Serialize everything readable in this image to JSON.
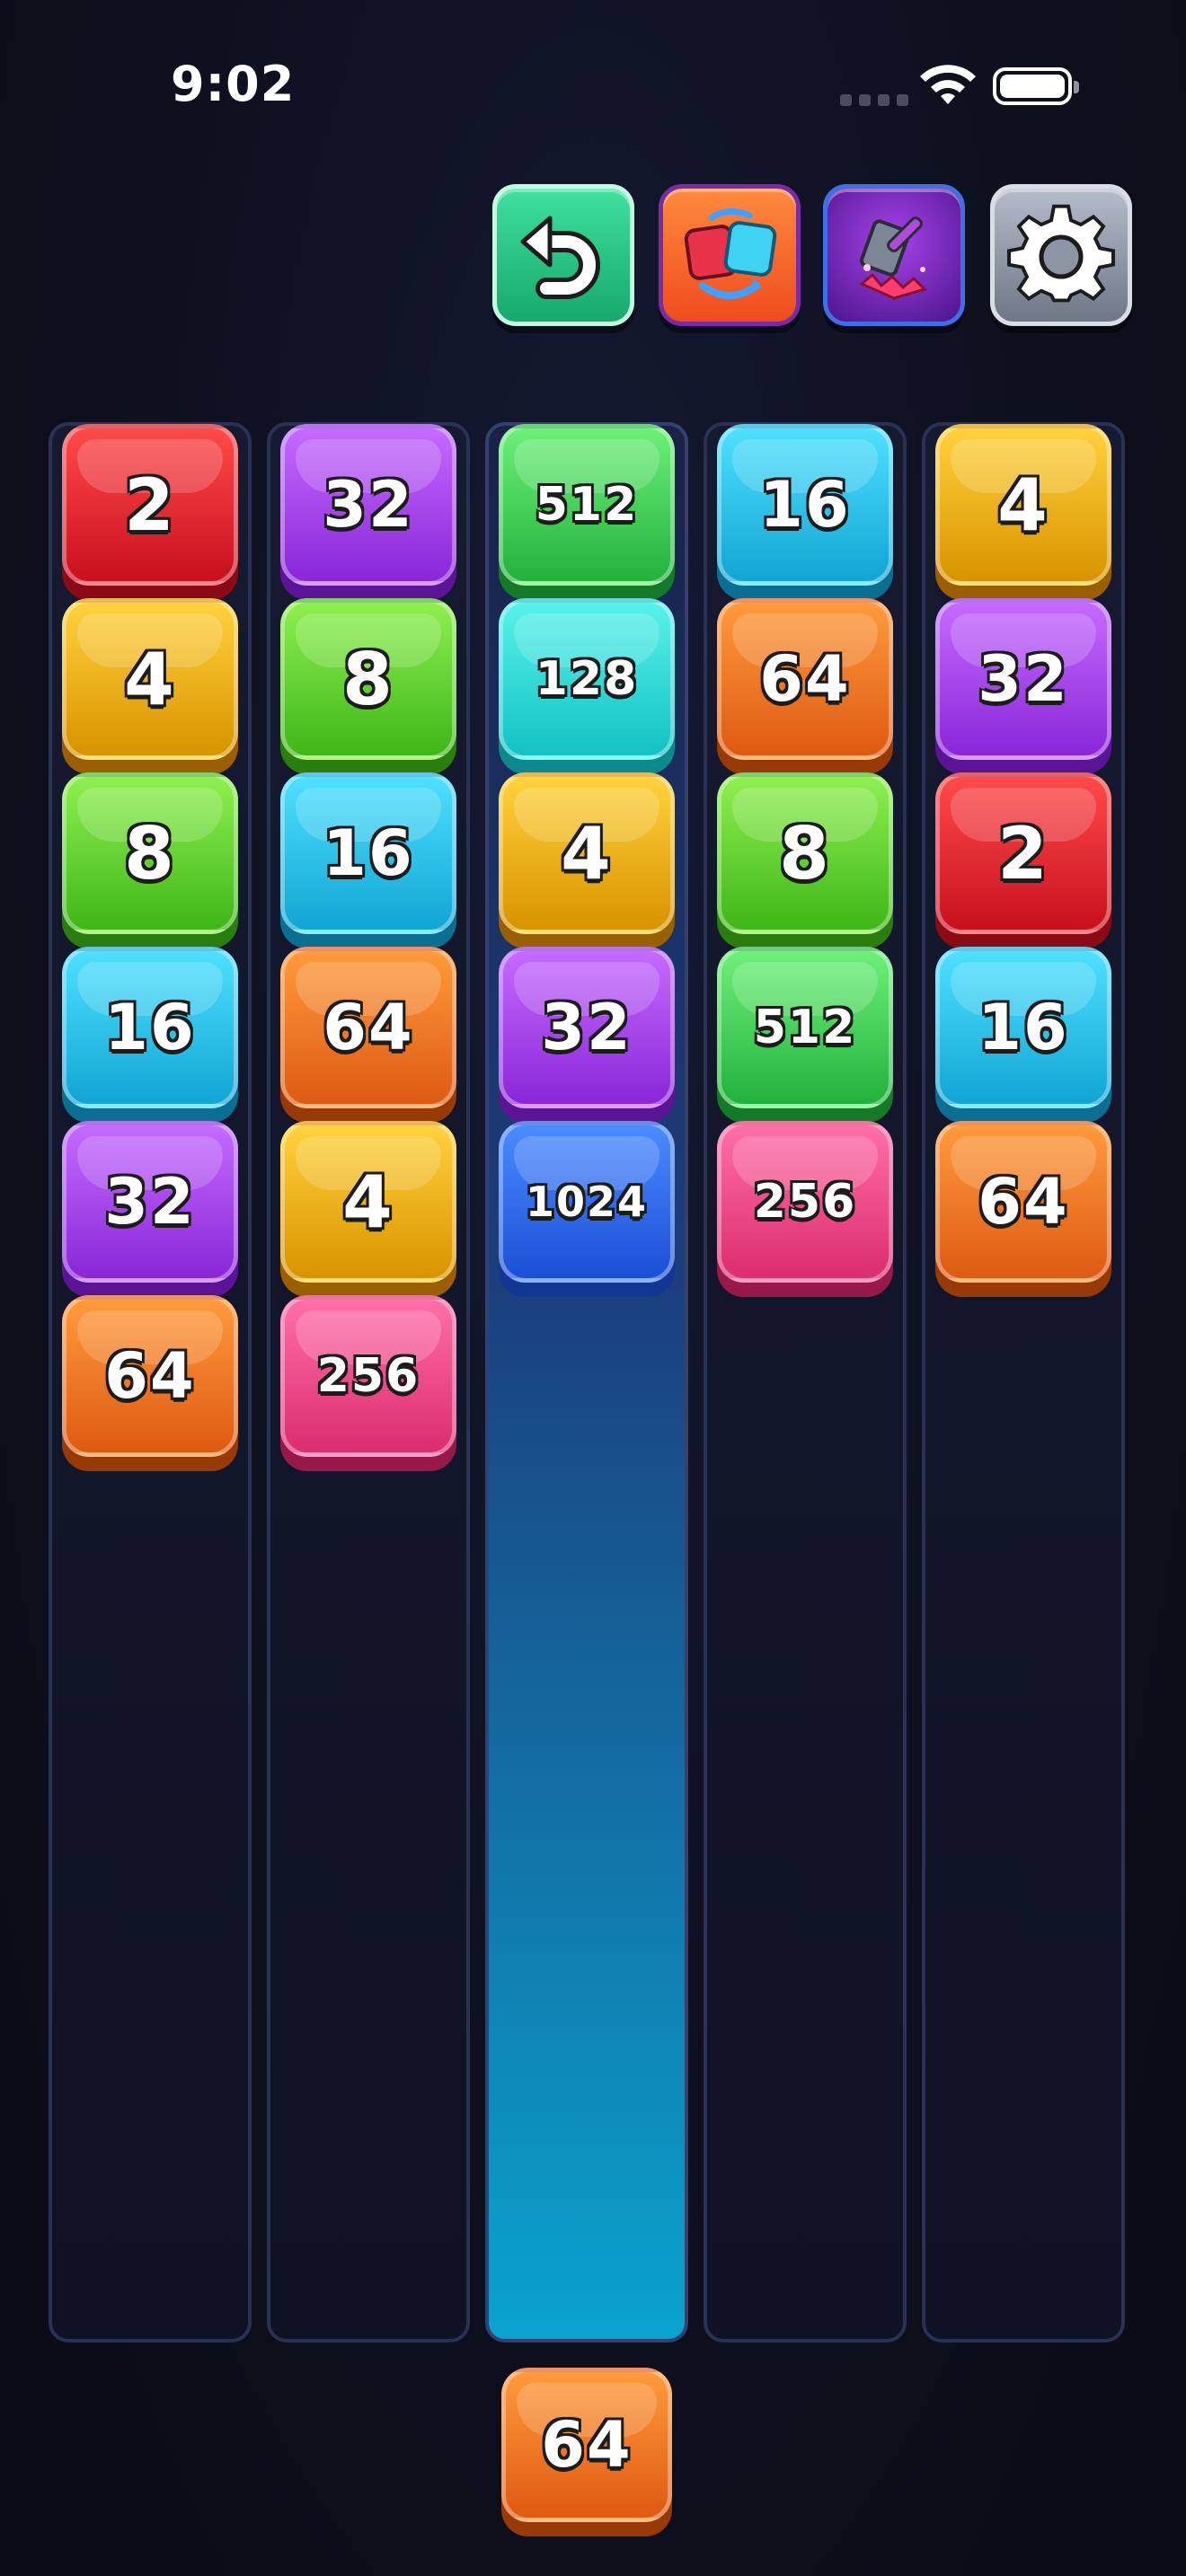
{
  "status_bar": {
    "time": "9:02"
  },
  "toolbar": {
    "buttons": [
      {
        "name": "undo",
        "icon": "undo-arrow-icon"
      },
      {
        "name": "swap",
        "icon": "swap-tiles-icon"
      },
      {
        "name": "hammer",
        "icon": "hammer-smash-icon"
      },
      {
        "name": "settings",
        "icon": "gear-icon"
      }
    ]
  },
  "board": {
    "columns": [
      {
        "tiles": [
          "2",
          "4",
          "8",
          "16",
          "32",
          "64"
        ]
      },
      {
        "tiles": [
          "32",
          "8",
          "16",
          "64",
          "4",
          "256"
        ]
      },
      {
        "tiles": [
          "512",
          "128",
          "4",
          "32",
          "1024"
        ],
        "highlighted": true
      },
      {
        "tiles": [
          "16",
          "64",
          "8",
          "512",
          "256"
        ]
      },
      {
        "tiles": [
          "4",
          "32",
          "2",
          "16",
          "64"
        ]
      }
    ]
  },
  "next_tile": {
    "value": "64"
  },
  "colors": {
    "2": "#d81a26",
    "4": "#eaa90f",
    "8": "#55c62a",
    "16": "#1fb7e0",
    "32": "#9b36e2",
    "64": "#ea6e1e",
    "128": "#22cfd0",
    "256": "#e53e7c",
    "512": "#36c248",
    "1024": "#2a62e2",
    "active_column": "#0aa3cf"
  }
}
